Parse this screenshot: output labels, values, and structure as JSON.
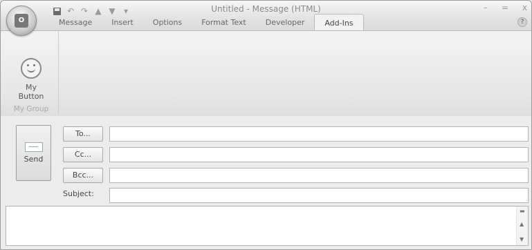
{
  "app": {
    "title": "Untitled - Message (HTML)",
    "office_button_icon": "office-logo-icon"
  },
  "quick_access": {
    "icons": [
      "save-icon",
      "undo-icon",
      "redo-icon",
      "up-arrow-icon",
      "down-arrow-icon",
      "customize-dropdown-icon"
    ]
  },
  "window_controls": {
    "minimize": "–",
    "maximize": "=",
    "close": "x"
  },
  "tabs": [
    {
      "label": "Message",
      "active": false
    },
    {
      "label": "Insert",
      "active": false
    },
    {
      "label": "Options",
      "active": false
    },
    {
      "label": "Format Text",
      "active": false
    },
    {
      "label": "Developer",
      "active": false
    },
    {
      "label": "Add-Ins",
      "active": true
    }
  ],
  "help": "?",
  "ribbon": {
    "group_label": "My Group",
    "button_label_line1": "My",
    "button_label_line2": "Button",
    "button_icon": "smiley-icon"
  },
  "compose": {
    "send_label": "Send",
    "to_label": "To...",
    "cc_label": "Cc...",
    "bcc_label": "Bcc...",
    "subject_label": "Subject:",
    "to_value": "",
    "cc_value": "",
    "bcc_value": "",
    "subject_value": "",
    "body_value": ""
  }
}
